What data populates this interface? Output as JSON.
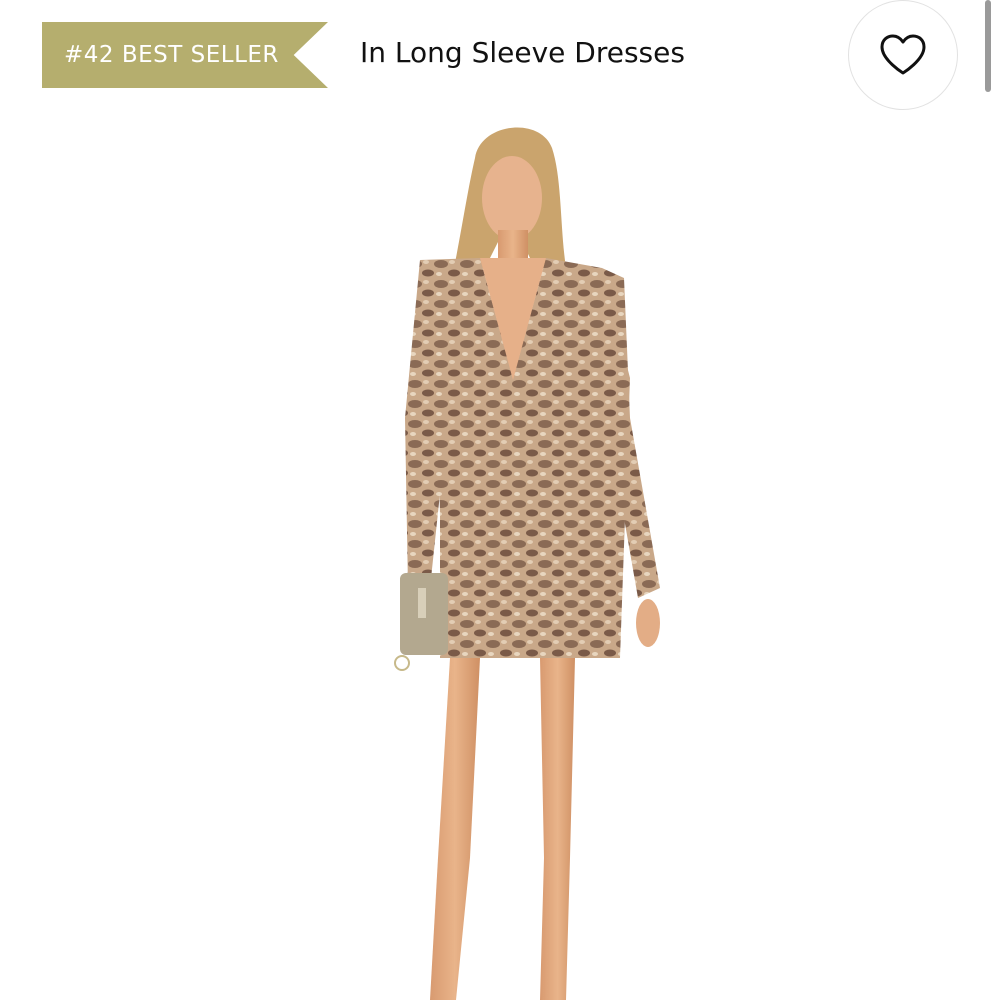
{
  "badge": {
    "text": "#42 BEST SELLER",
    "color": "#b5ae6e"
  },
  "category": {
    "text": "In Long Sleeve Dresses"
  },
  "favorite": {
    "icon": "heart-outline-icon"
  },
  "product_image": {
    "subject": "model wearing snakeskin print long sleeve mini dress holding clutch"
  }
}
